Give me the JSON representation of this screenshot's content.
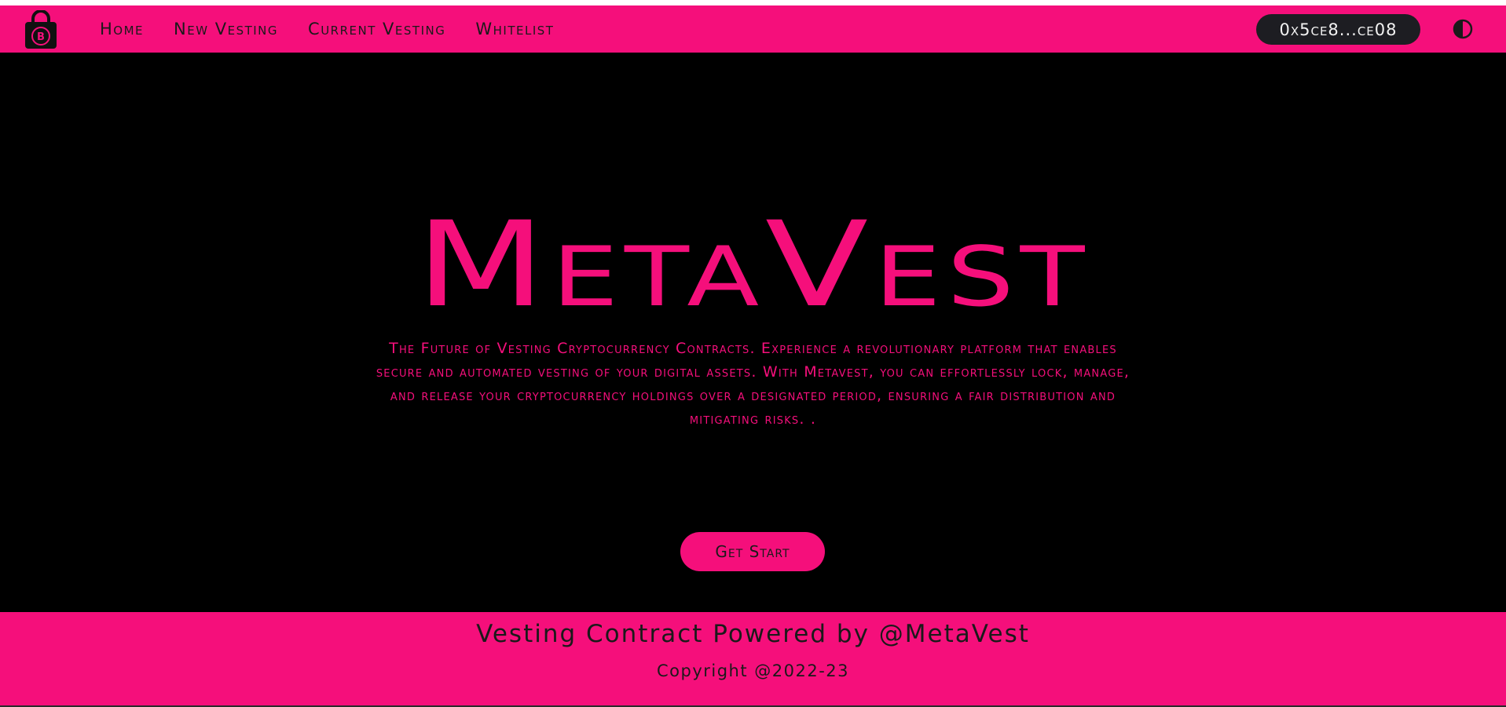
{
  "theme": {
    "accent_color": "#f50f7b",
    "background_color": "#000000",
    "dark_pill_color": "#1d1d22"
  },
  "navbar": {
    "logo_icon": "bitcoin-lock-icon",
    "links": [
      {
        "label": "Home"
      },
      {
        "label": "New Vesting"
      },
      {
        "label": "Current Vesting"
      },
      {
        "label": "Whitelist"
      }
    ],
    "wallet_address": "0x5ce8...ce08",
    "theme_toggle_icon": "contrast-icon"
  },
  "hero": {
    "title": "MetaVest",
    "description": "The Future of Vesting Cryptocurrency Contracts. Experience a revolutionary platform that enables secure and automated vesting of your digital assets. With Metavest, you can effortlessly lock, manage, and release your cryptocurrency holdings over a designated period, ensuring a fair distribution and mitigating risks. .",
    "cta_label": "Get Start"
  },
  "footer": {
    "title": "Vesting Contract Powered by @MetaVest",
    "copyright": "Copyright @2022-23"
  }
}
